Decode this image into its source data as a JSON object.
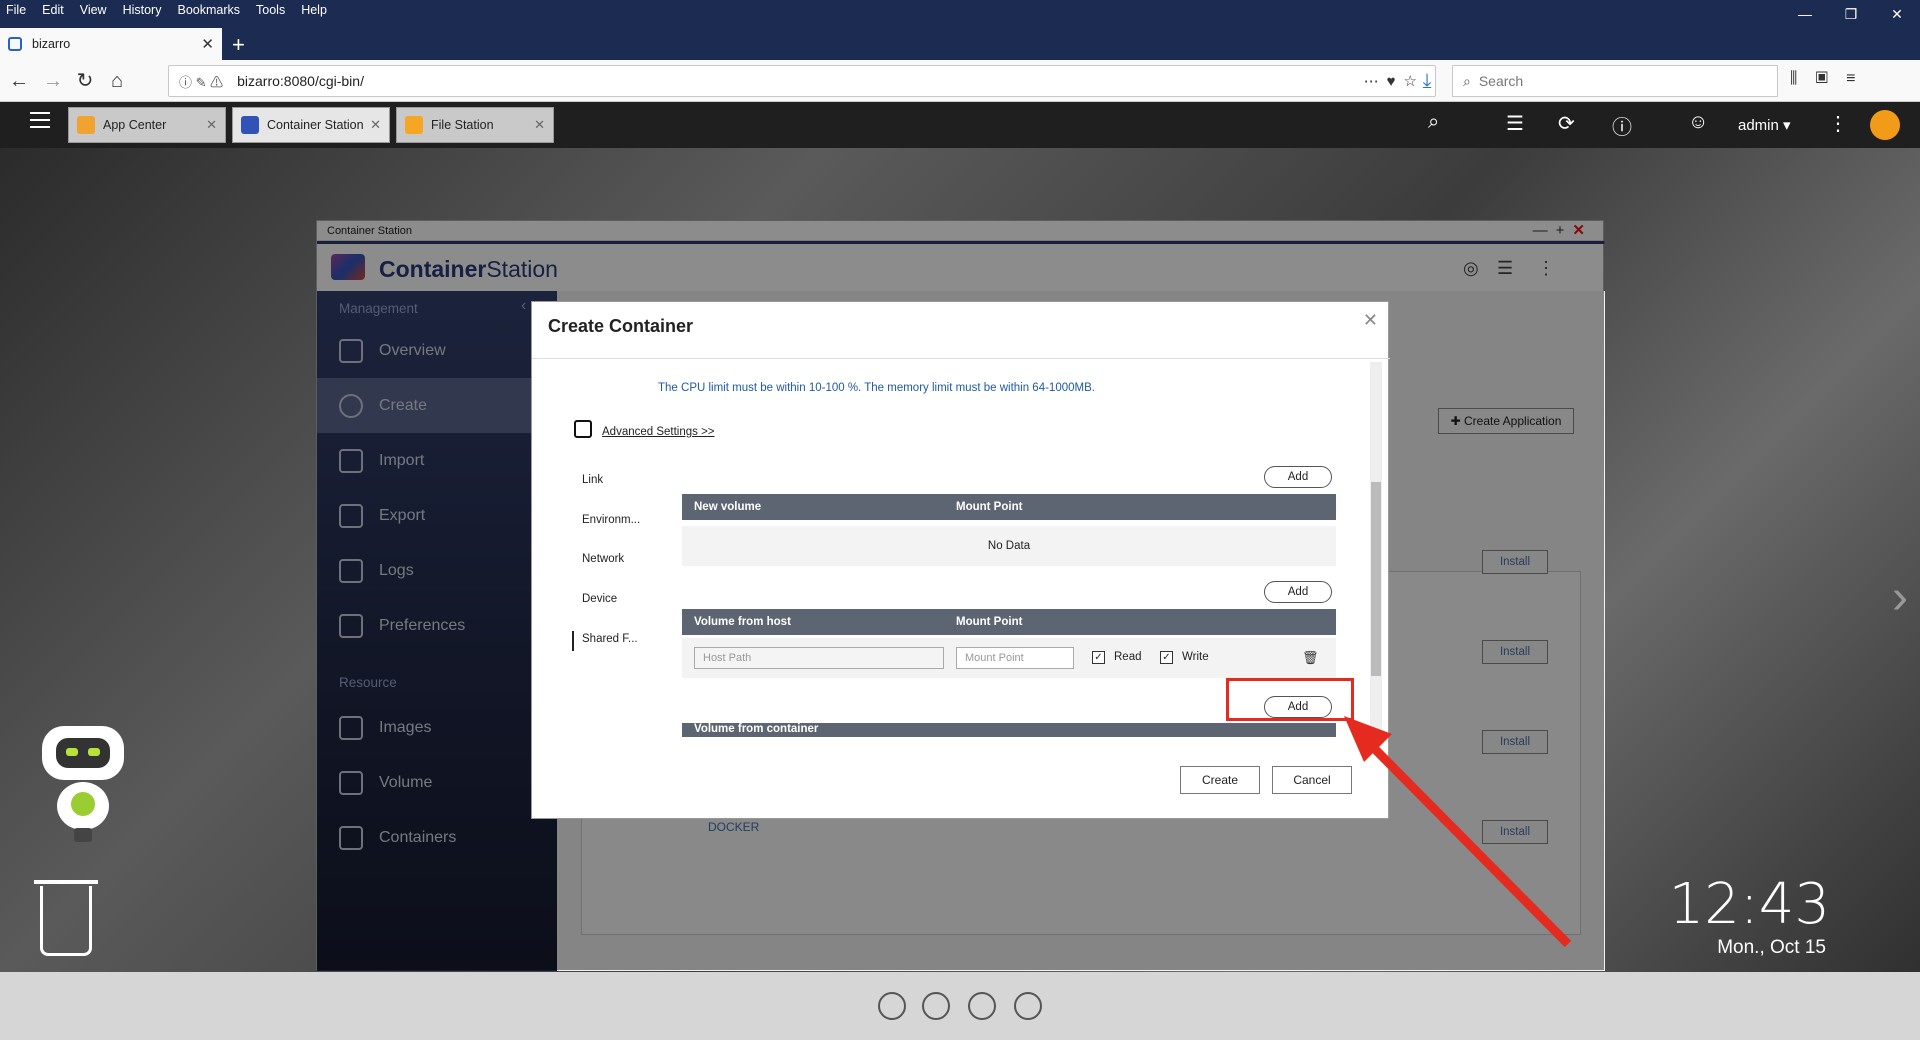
{
  "browser": {
    "menu": [
      "File",
      "Edit",
      "View",
      "History",
      "Bookmarks",
      "Tools",
      "Help"
    ],
    "tab_title": "bizarro",
    "url": "bizarro:8080/cgi-bin/",
    "search_placeholder": "Search"
  },
  "qts": {
    "app_tabs": [
      {
        "label": "App Center",
        "color": "#f0a330"
      },
      {
        "label": "Container Station",
        "color": "#3153b8"
      },
      {
        "label": "File Station",
        "color": "#f5a623"
      }
    ],
    "user": "admin ▾"
  },
  "container_station": {
    "window_title": "Container Station",
    "brand_a": "Container",
    "brand_b": "Station",
    "sidebar": {
      "management_label": "Management",
      "resource_label": "Resource",
      "items": [
        "Overview",
        "Create",
        "Import",
        "Export",
        "Logs",
        "Preferences",
        "Images",
        "Volume",
        "Containers"
      ]
    },
    "create_application": "✚ Create Application",
    "install_label": "Install",
    "docker_label": "DOCKER"
  },
  "dialog": {
    "title": "Create Container",
    "cpu_note": "The CPU limit must be within 10-100 %. The memory limit must be within 64-1000MB.",
    "advanced_settings": "Advanced Settings >>",
    "tabs": [
      "Link",
      "Environm...",
      "Network",
      "Device",
      "Shared F..."
    ],
    "add_label": "Add",
    "new_volume_header": "New volume",
    "mount_point_header": "Mount Point",
    "no_data": "No Data",
    "volume_from_host_header": "Volume from host",
    "host_path_placeholder": "Host Path",
    "mount_point_placeholder": "Mount Point",
    "read_label": "Read",
    "write_label": "Write",
    "volume_from_container_header": "Volume from container",
    "create_button": "Create",
    "cancel_button": "Cancel"
  },
  "desktop": {
    "time": "12:43",
    "date": "Mon., Oct 15"
  },
  "colors": {
    "browser_dark": "#1b2b52",
    "sidebar": "#202744",
    "annotation_red": "#e52b20",
    "link_blue": "#1f5aa6"
  }
}
